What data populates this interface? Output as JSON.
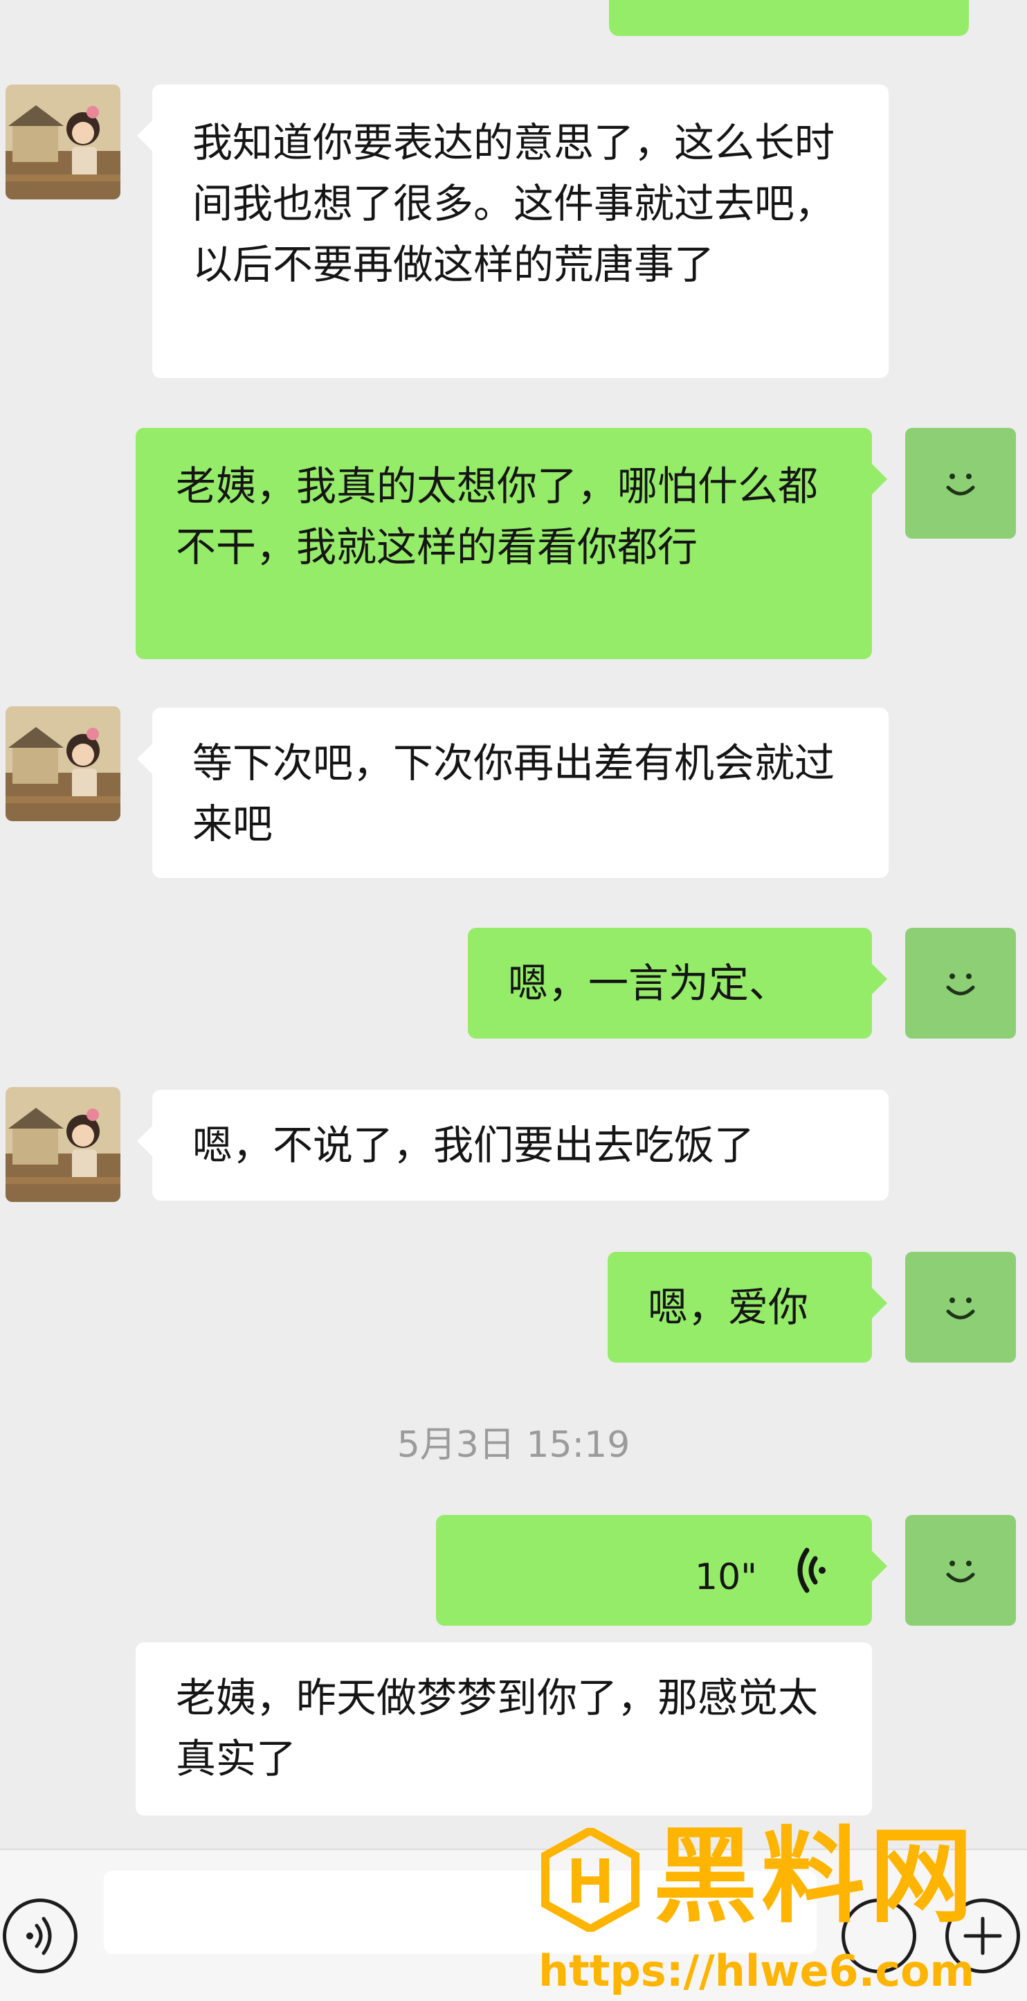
{
  "messages": [
    {
      "side": "in",
      "text": "我知道你要表达的意思了，这么长时间我也想了很多。这件事就过去吧，以后不要再做这样的荒唐事了"
    },
    {
      "side": "out",
      "text": "老姨，我真的太想你了，哪怕什么都不干，我就这样的看看你都行"
    },
    {
      "side": "in",
      "text": "等下次吧，下次你再出差有机会就过来吧"
    },
    {
      "side": "out",
      "text": "嗯，一言为定、"
    },
    {
      "side": "in",
      "text": "嗯，不说了，我们要出去吃饭了"
    },
    {
      "side": "out",
      "text": "嗯，爱你"
    },
    {
      "side": "out",
      "type": "voice",
      "duration": "10\""
    },
    {
      "side": "in",
      "text": "老姨，昨天做梦梦到你了，那感觉太真实了"
    }
  ],
  "timestamp": "5月3日 15:19",
  "bottom_bar": {
    "voice_icon": "voice-mode-icon",
    "emoji_icon": "emoji-icon",
    "plus_icon": "plus-icon"
  },
  "watermark": {
    "title": "黑料网",
    "url": "https://hlwe6.com",
    "logo": "hl-logo-icon"
  },
  "colors": {
    "background": "#ededed",
    "outgoing_bubble": "#95ec69",
    "incoming_bubble": "#ffffff",
    "self_avatar": "#8ccf74",
    "watermark": "#ffb400"
  }
}
